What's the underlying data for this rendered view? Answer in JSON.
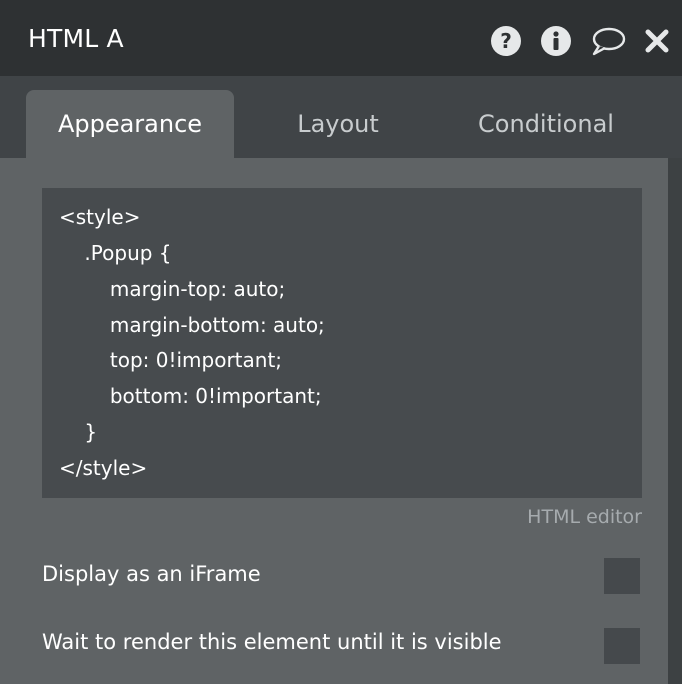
{
  "window": {
    "title": "HTML A",
    "icons": [
      "question-icon",
      "info-icon",
      "comment-icon",
      "close-icon"
    ]
  },
  "tabs": [
    {
      "label": "Appearance",
      "active": true
    },
    {
      "label": "Layout",
      "active": false
    },
    {
      "label": "Conditional",
      "active": false
    }
  ],
  "editor": {
    "lines": [
      "<style>",
      "    .Popup {",
      "        margin-top: auto;",
      "        margin-bottom: auto;",
      "        top: 0!important;",
      "        bottom: 0!important;",
      "    }",
      "</style>"
    ],
    "caption": "HTML editor"
  },
  "options": [
    {
      "label": "Display as an iFrame",
      "checked": false
    },
    {
      "label": "Wait to render this element until it is visible",
      "checked": false
    }
  ],
  "colors": {
    "titlebar": "#2e3133",
    "tabbar": "#404447",
    "panel": "#5f6365",
    "editor": "#474b4e",
    "icon": "#e6e8e9"
  }
}
